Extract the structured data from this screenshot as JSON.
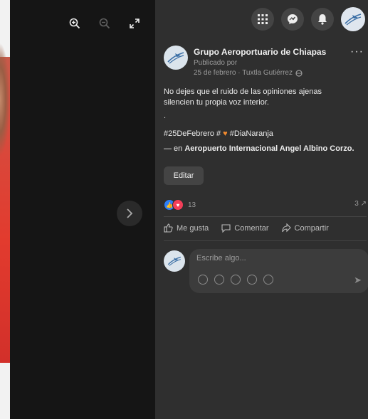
{
  "viewer": {
    "tools": [
      {
        "name": "zoom-in-icon",
        "dim": false
      },
      {
        "name": "zoom-out-icon",
        "dim": true
      },
      {
        "name": "fullscreen-icon",
        "dim": false
      }
    ]
  },
  "topbar": {
    "icons": [
      "menu-grid-icon",
      "messenger-icon",
      "notifications-bell-icon",
      "profile-avatar"
    ]
  },
  "post": {
    "page_name": "Grupo Aeroportuario de Chiapas",
    "more": "···",
    "published_by": "Publicado por",
    "date_location": "25 de febrero · Tuxtla Gutiérrez",
    "text_line1": "No dejes que el ruido de las opiniones ajenas",
    "text_line2": "silencien tu propia voz interior.",
    "dot": ".",
    "hashtag1": "#25DeFebrero #",
    "hashtag2": "#DiaNaranja",
    "location_prefix": "— en",
    "location_name": "Aeropuerto Internacional Angel Albino Corzo.",
    "edit_label": "Editar",
    "reaction_count": "13",
    "shares": "3 ↗"
  },
  "actions": {
    "like": "Me gusta",
    "comment": "Comentar",
    "share": "Compartir"
  },
  "comment": {
    "placeholder": "Escribe algo..."
  }
}
